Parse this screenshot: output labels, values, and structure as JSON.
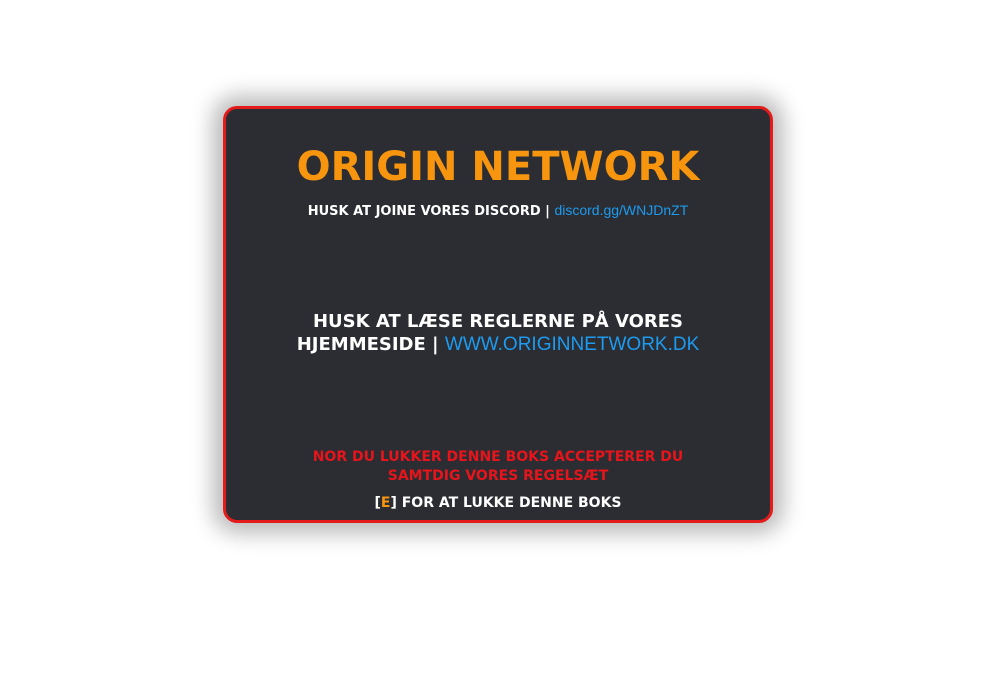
{
  "dialog": {
    "title": "ORIGIN NETWORK",
    "discord": {
      "text": "HUSK AT JOINE VORES DISCORD | ",
      "link": "discord.gg/WNJDnZT"
    },
    "rules": {
      "text": "HUSK AT LÆSE REGLERNE PÅ VORES HJEMMESIDE | ",
      "link": "WWW.ORIGINNETWORK.DK"
    },
    "accept_notice": "NOR DU LUKKER DENNE BOKS ACCEPTERER DU SAMTDIG VORES REGELSÆT",
    "close_hint": {
      "open_bracket": "[",
      "key": "E",
      "close_bracket": "]",
      "text": " FOR AT LUKKE DENNE BOKS"
    }
  },
  "colors": {
    "background": "#ffffff",
    "panel": "#2b2d32",
    "border": "#e31b1b",
    "title": "#f7950f",
    "link": "#1d9bf0",
    "warning": "#e8141b",
    "key": "#f7950f",
    "text": "#ffffff"
  }
}
